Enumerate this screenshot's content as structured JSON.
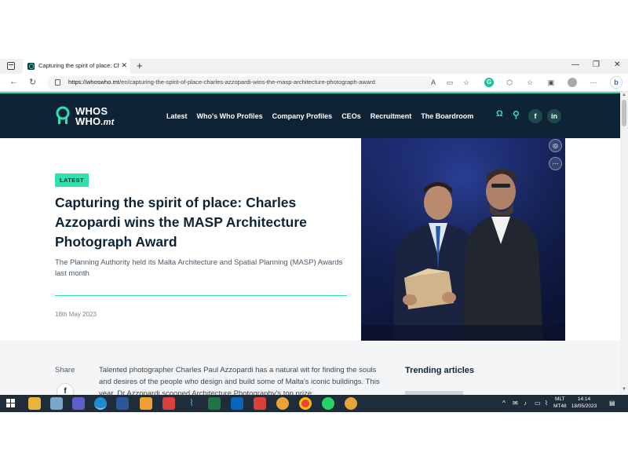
{
  "browser": {
    "tab_title": "Capturing the spirit of place: Cha",
    "url_domain": "https://whoswho.mt",
    "url_path": "/en/capturing-the-spirit-of-place-charles-azzopardi-wins-the-masp-architecture-photograph-award"
  },
  "site": {
    "logo_line1": "WHOS",
    "logo_line2": "WHO",
    "logo_suffix": ".mt",
    "nav": [
      "Latest",
      "Who's Who Profiles",
      "Company Profiles",
      "CEOs",
      "Recruitment",
      "The Boardroom"
    ],
    "accent_color": "#2fe0b0",
    "header_color": "#0e2436"
  },
  "article": {
    "badge": "LATEST",
    "title": "Capturing the spirit of place: Charles Azzopardi wins the MASP Architecture Photograph Award",
    "subtitle": "The Planning Authority held its Malta Architecture and Spatial Planning (MASP) Awards last month",
    "date": "18th May 2023",
    "share_label": "Share",
    "body": "Talented photographer Charles Paul Azzopardi has a natural wit for finding the souls and desires of the people who design and build some of Malta's iconic buildings. This year, Dr Azzopardi scooped Architecture Photography's top prize"
  },
  "sidebar": {
    "trending_title": "Trending articles"
  },
  "taskbar": {
    "lang_line1": "MLT",
    "lang_line2": "MT48",
    "time": "14:14",
    "date": "18/05/2023"
  }
}
